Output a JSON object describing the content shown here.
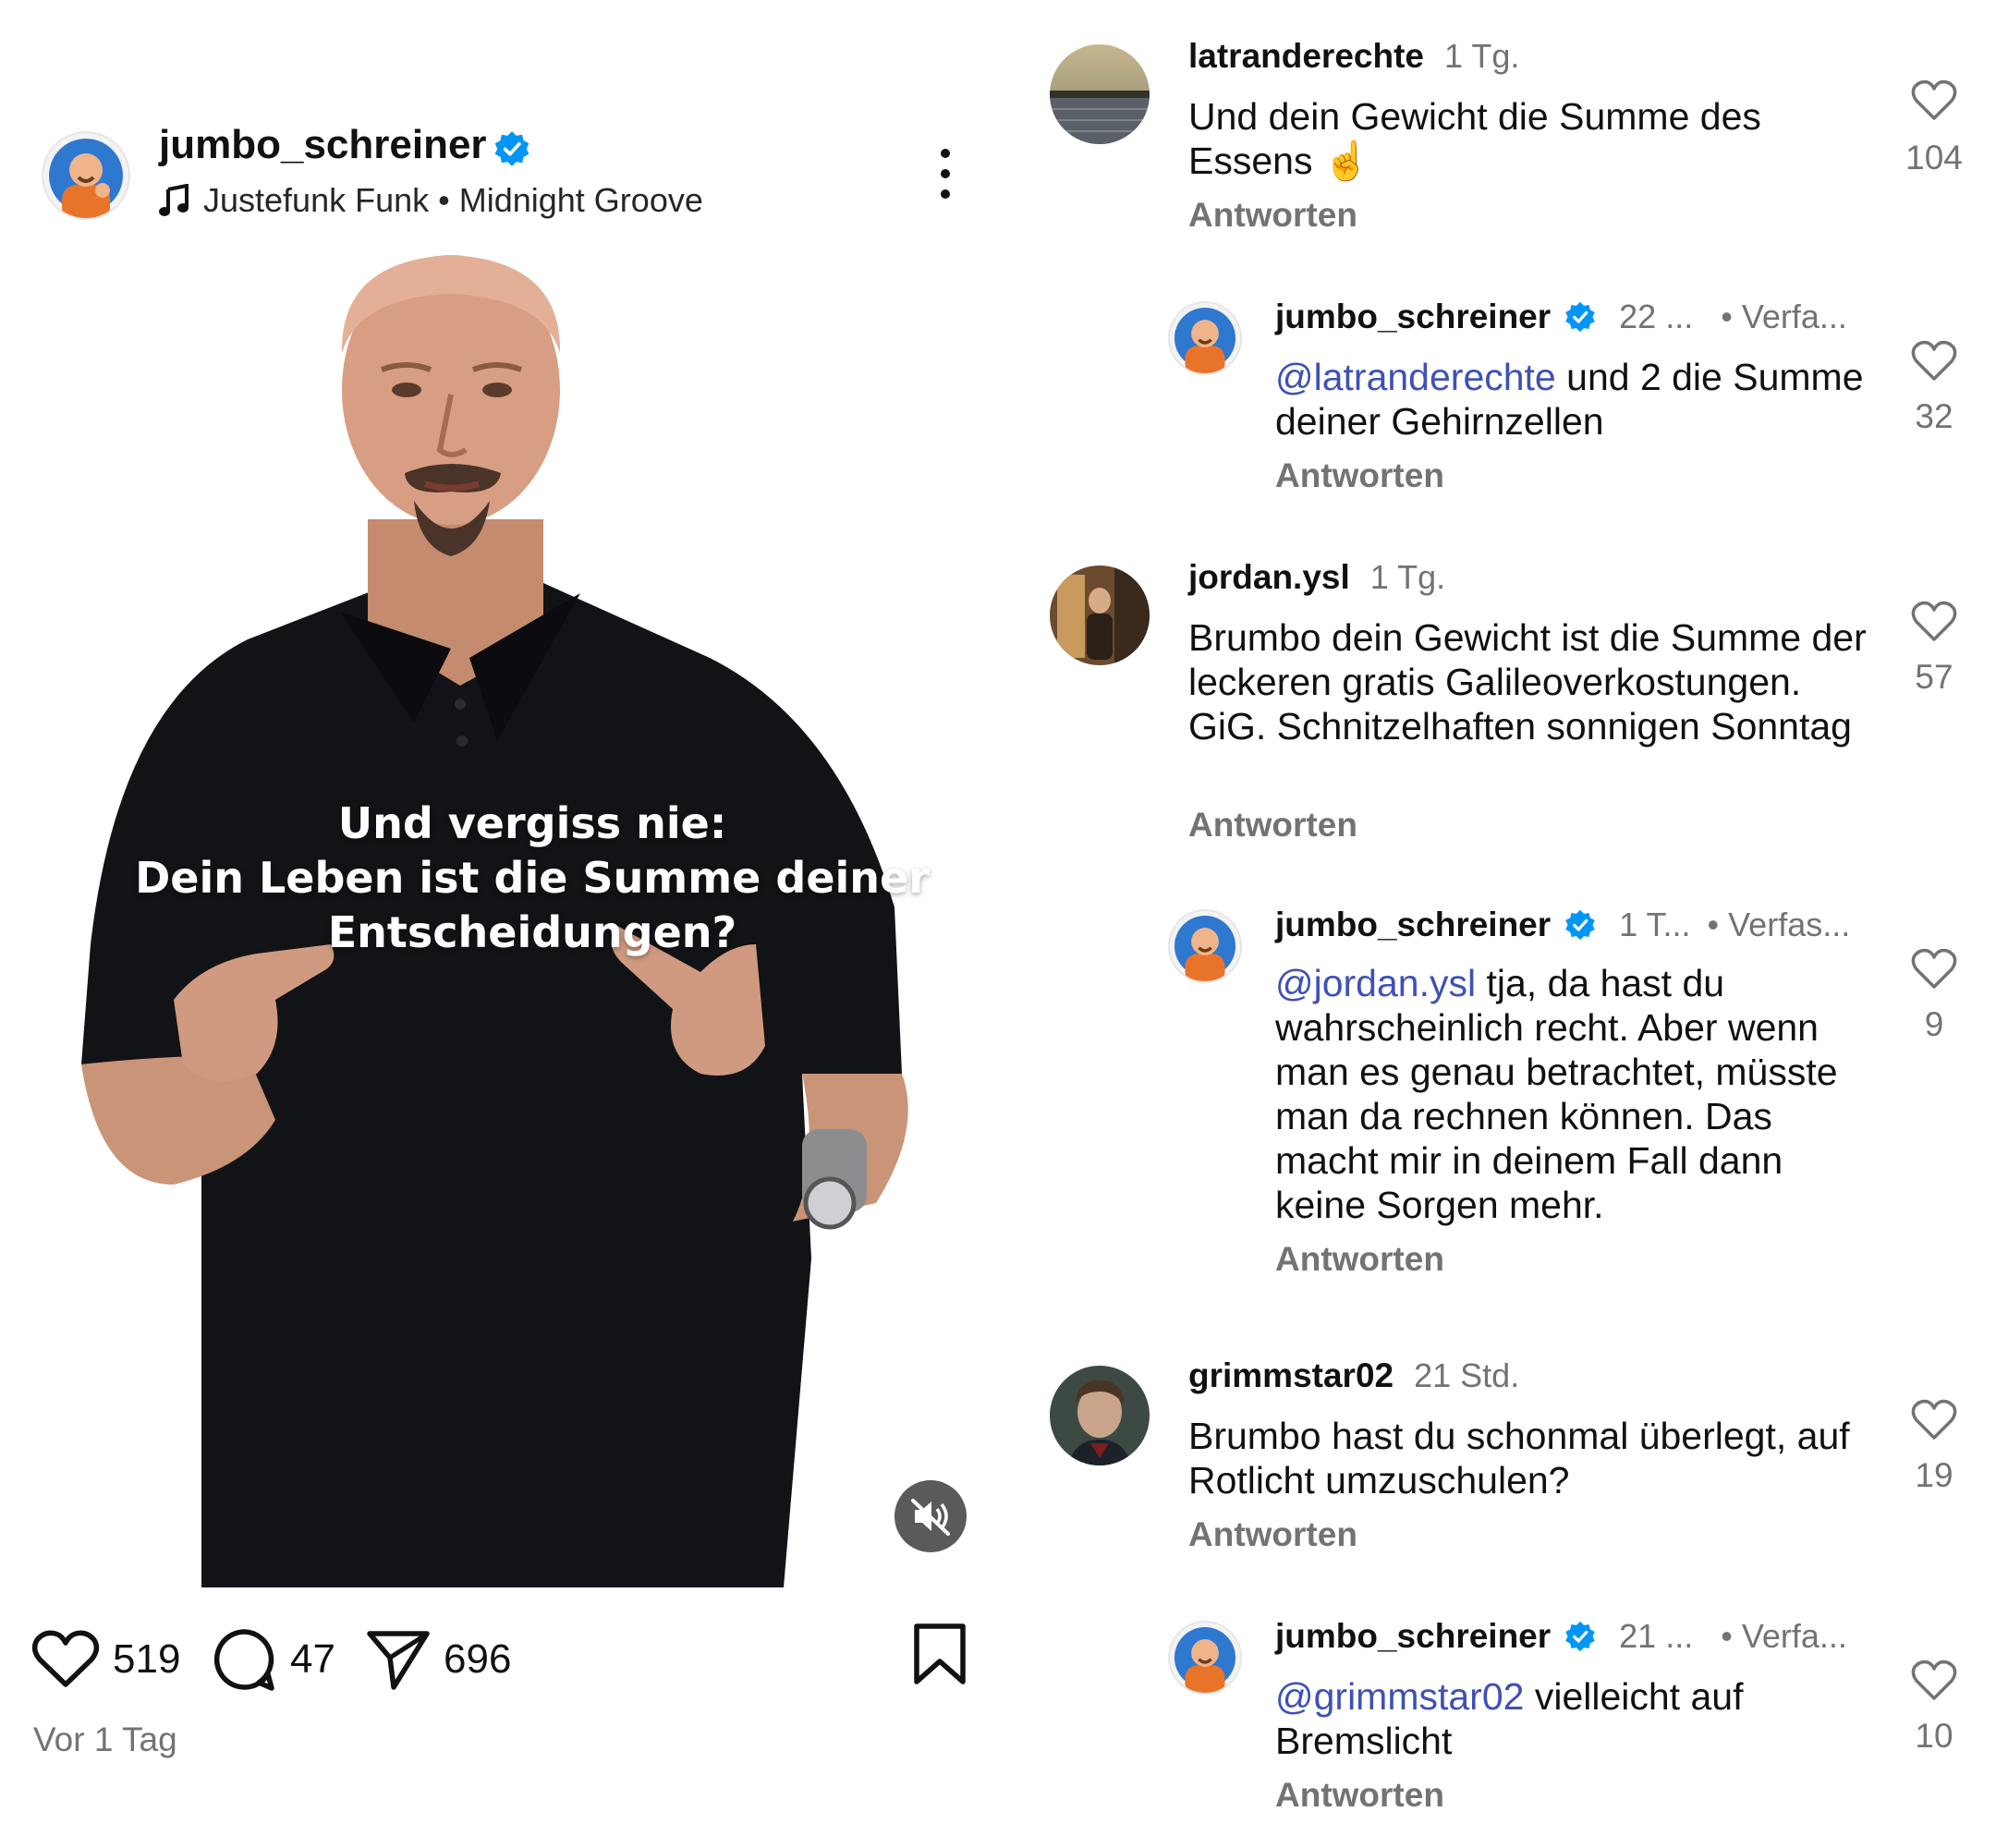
{
  "post": {
    "username": "jumbo_schreiner",
    "music": "Justefunk Funk • Midnight Groove",
    "overlay_lines": [
      "Und vergiss nie:",
      "Dein Leben ist die Summe deiner",
      "Entscheidungen?"
    ],
    "likes": "519",
    "comments": "47",
    "shares": "696",
    "time": "Vor 1 Tag",
    "muted": true
  },
  "comments": [
    {
      "username": "latranderechte",
      "time": "1 Tg.",
      "text": "Und dein Gewicht die Summe des Essens ☝️",
      "reply_label": "Antworten",
      "likes": "104"
    },
    {
      "username": "jumbo_schreiner",
      "time": "22 ...",
      "author_tag": "• Verfa...",
      "mention": "@latranderechte",
      "text": " und 2 die Summe deiner Gehirnzellen",
      "reply_label": "Antworten",
      "likes": "32",
      "is_reply": true
    },
    {
      "username": "jordan.ysl",
      "time": "1 Tg.",
      "text": "Brumbo dein Gewicht ist die Summe der leckeren gratis Galileoverkostungen. GiG. Schnitzelhaften sonnigen Sonntag",
      "reply_label": "Antworten",
      "likes": "57"
    },
    {
      "username": "jumbo_schreiner",
      "time": "1 T...",
      "author_tag": "• Verfas...",
      "mention": "@jordan.ysl",
      "text": " tja, da hast du wahrscheinlich recht. Aber wenn man es genau betrachtet, müsste man da rechnen können. Das macht mir in deinem Fall dann keine Sorgen mehr.",
      "reply_label": "Antworten",
      "likes": "9",
      "is_reply": true
    },
    {
      "username": "grimmstar02",
      "time": "21 Std.",
      "text": "Brumbo hast du schonmal überlegt, auf Rotlicht umzuschulen?",
      "reply_label": "Antworten",
      "likes": "19"
    },
    {
      "username": "jumbo_schreiner",
      "time": "21 ...",
      "author_tag": "• Verfa...",
      "mention": "@grimmstar02",
      "text": " vielleicht auf Bremslicht",
      "reply_label": "Antworten",
      "likes": "10",
      "is_reply": true
    }
  ],
  "colors": {
    "verified": "#0095f6",
    "mention": "#3f51b5",
    "muted_text": "#737373"
  }
}
